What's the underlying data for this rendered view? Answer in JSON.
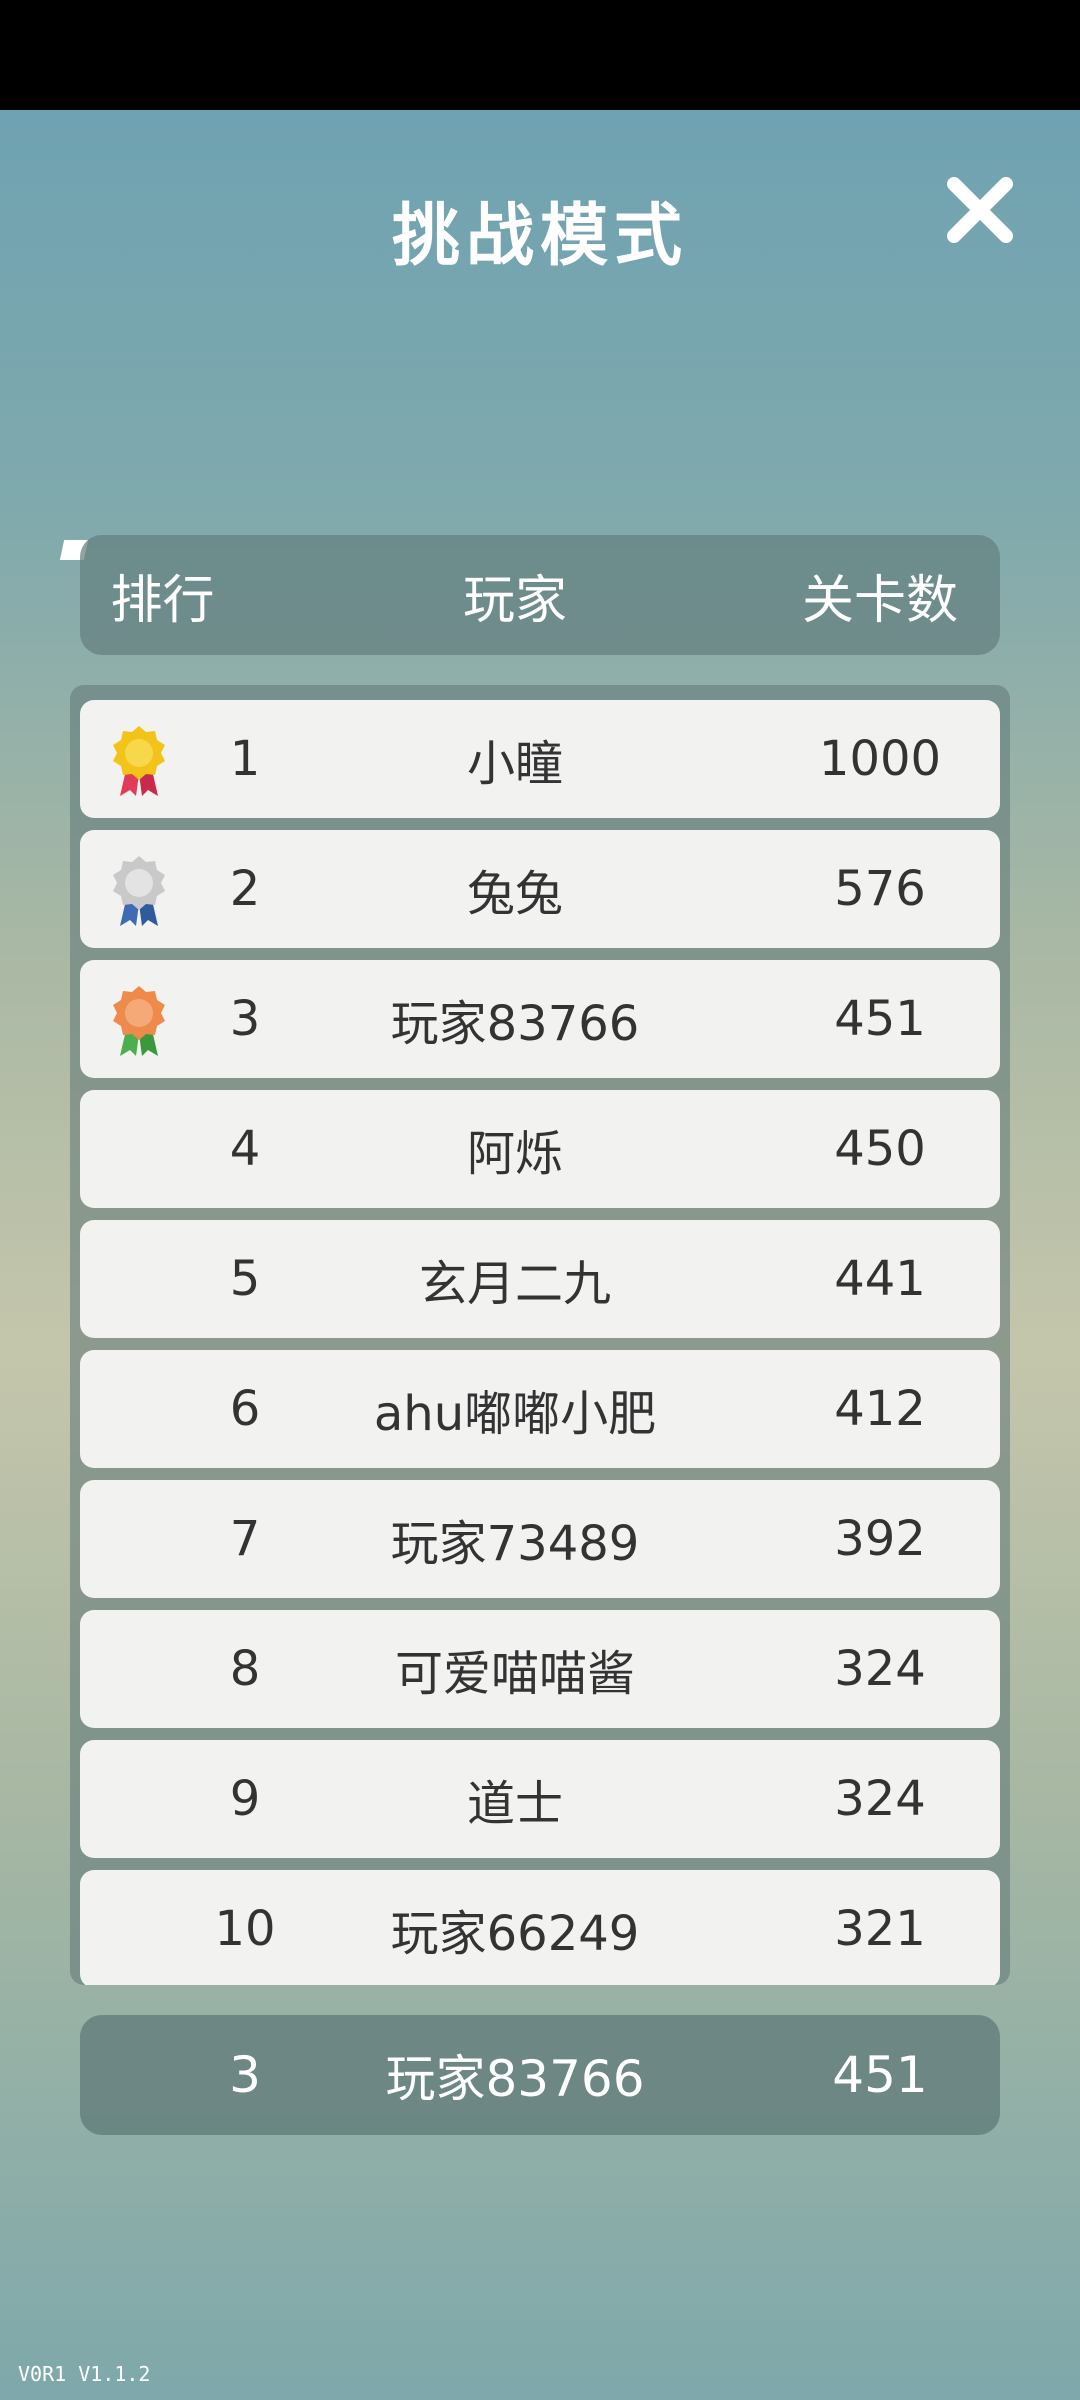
{
  "screen": {
    "title": "挑战模式",
    "version": "V0R1 V1.1.2"
  },
  "header": {
    "rank": "排行",
    "player": "玩家",
    "levels": "关卡数"
  },
  "colors": {
    "gold_medal": "#f2c419",
    "silver_medal": "#d9d9d9",
    "bronze_medal": "#f2965a",
    "row_background": "#f2f2f1"
  },
  "leaderboard": [
    {
      "rank": "1",
      "player": "小瞳",
      "levels": "1000",
      "medal": "gold-medal-icon"
    },
    {
      "rank": "2",
      "player": "兔兔",
      "levels": "576",
      "medal": "silver-medal-icon"
    },
    {
      "rank": "3",
      "player": "玩家83766",
      "levels": "451",
      "medal": "bronze-medal-icon"
    },
    {
      "rank": "4",
      "player": "阿烁",
      "levels": "450"
    },
    {
      "rank": "5",
      "player": "玄月二九",
      "levels": "441"
    },
    {
      "rank": "6",
      "player": "ahu嘟嘟小肥",
      "levels": "412"
    },
    {
      "rank": "7",
      "player": "玩家73489",
      "levels": "392"
    },
    {
      "rank": "8",
      "player": "可爱喵喵酱",
      "levels": "324"
    },
    {
      "rank": "9",
      "player": "道士",
      "levels": "324"
    },
    {
      "rank": "10",
      "player": "玩家66249",
      "levels": "321"
    }
  ],
  "my_rank": {
    "rank": "3",
    "player": "玩家83766",
    "levels": "451"
  }
}
